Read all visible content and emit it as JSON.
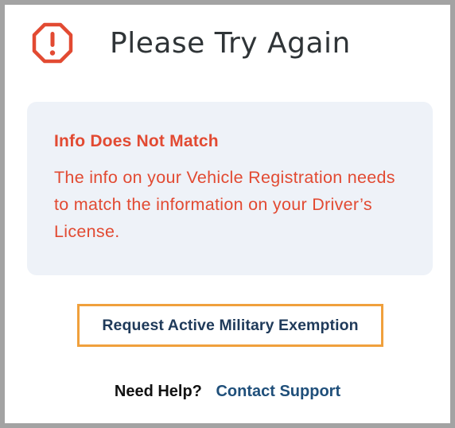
{
  "header": {
    "icon": "warning-octagon-icon",
    "title": "Please Try Again"
  },
  "error": {
    "title": "Info Does Not Match",
    "message": "The info on your Vehicle Registration needs to match the information on your Driver’s License."
  },
  "actions": {
    "exemption_label": "Request Active Military Exemption"
  },
  "help": {
    "label": "Need Help?",
    "link": "Contact Support"
  },
  "colors": {
    "error": "#e24a32",
    "box_bg": "#eef2f8",
    "link": "#1f4f7a",
    "focus_outline": "#f0a03c",
    "title": "#2f3437"
  }
}
